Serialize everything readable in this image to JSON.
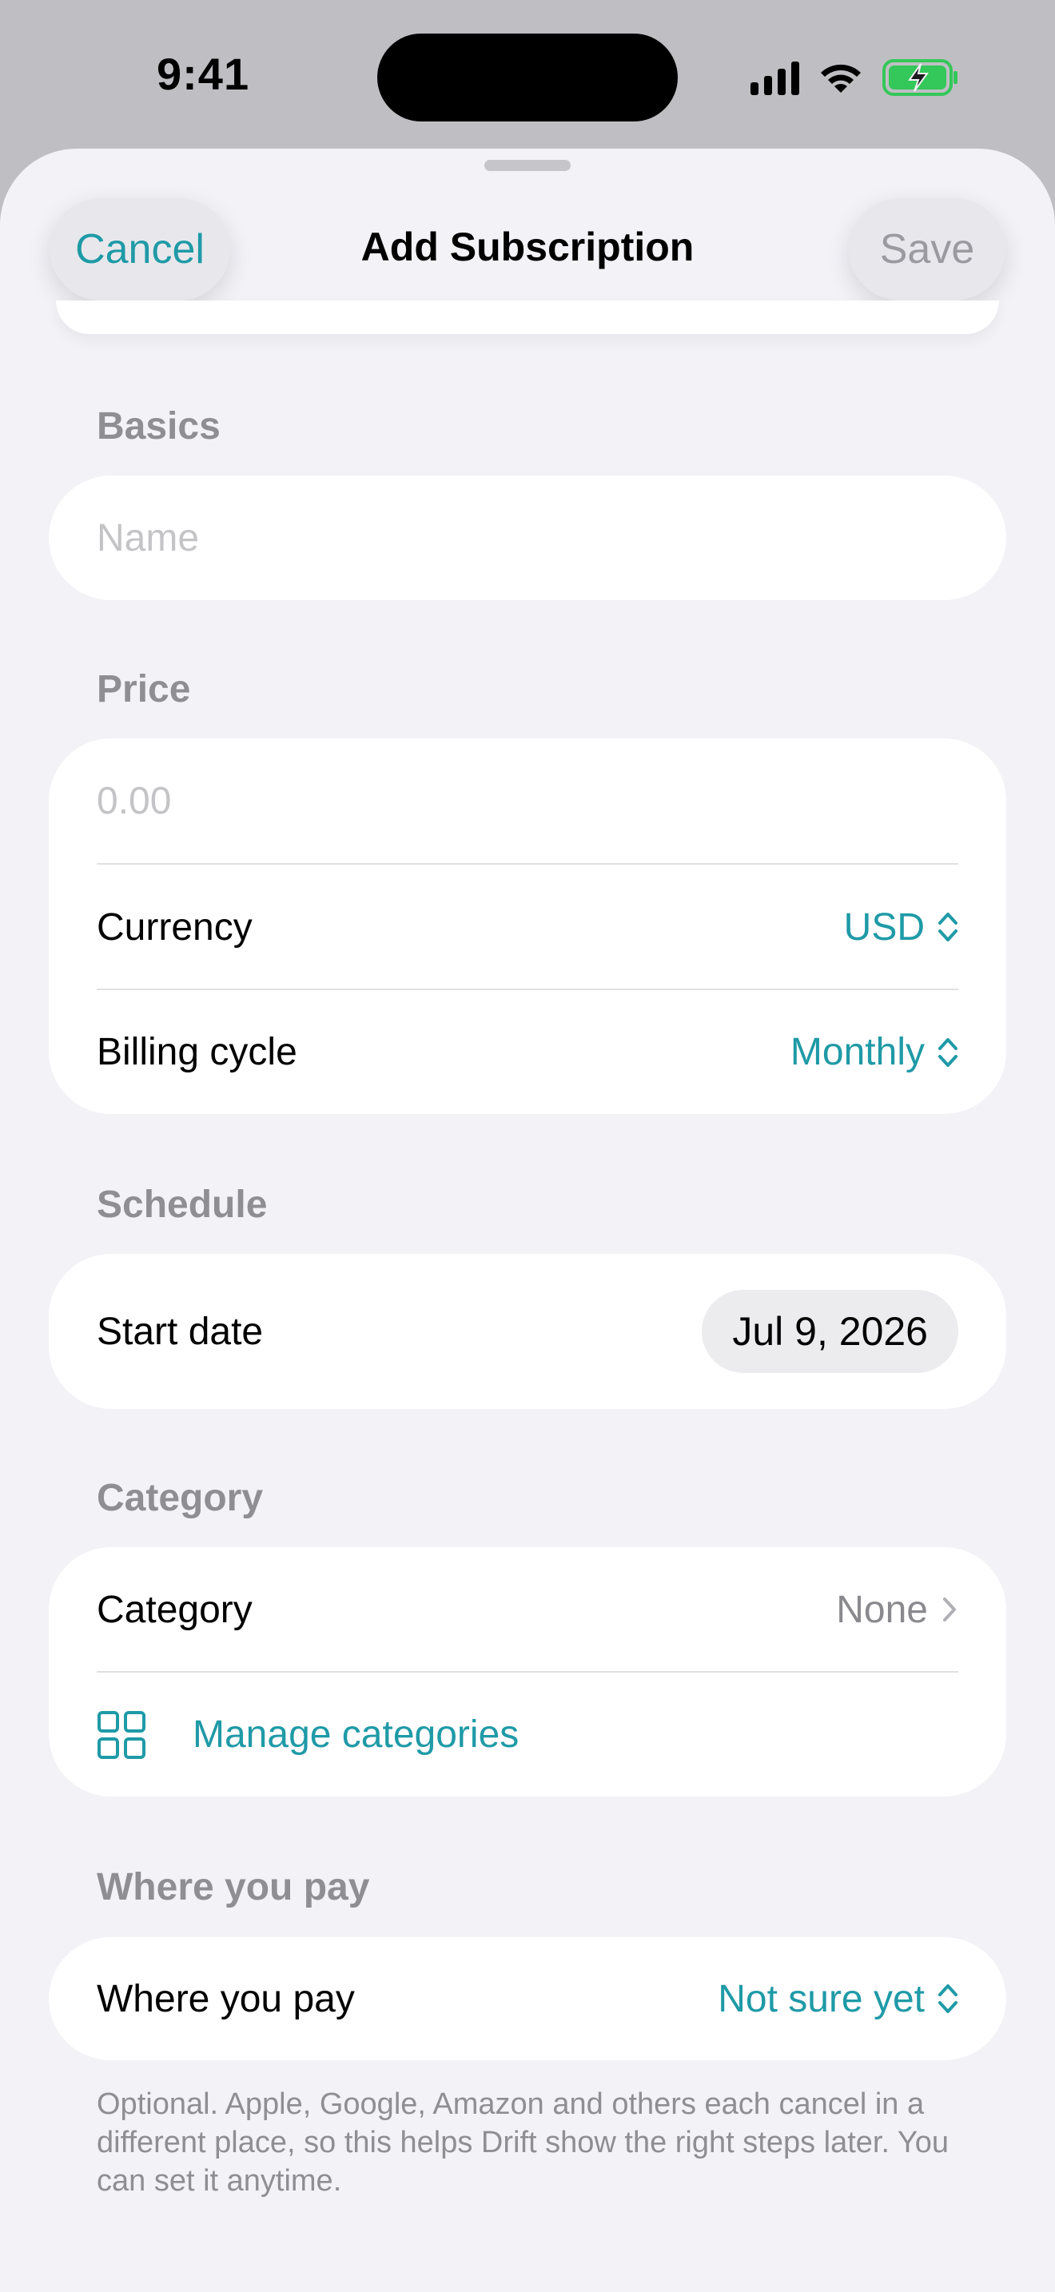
{
  "status_bar": {
    "time": "9:41",
    "icons": [
      "cellular-signal-icon",
      "wifi-icon",
      "battery-charging-icon"
    ],
    "battery_color": "#34c759"
  },
  "header": {
    "title": "Add Subscription",
    "cancel_label": "Cancel",
    "save_label": "Save",
    "save_enabled": false
  },
  "colors": {
    "accent": "#1f9aa7",
    "background": "#f2f2f7",
    "secondary_text": "#8e8e93"
  },
  "basics": {
    "header": "Basics",
    "name_placeholder": "Name",
    "name_value": ""
  },
  "price": {
    "header": "Price",
    "amount_placeholder": "0.00",
    "amount_value": "",
    "currency_label": "Currency",
    "currency_value": "USD",
    "billing_cycle_label": "Billing cycle",
    "billing_cycle_value": "Monthly"
  },
  "schedule": {
    "header": "Schedule",
    "start_date_label": "Start date",
    "start_date_value": "Jul 9, 2026"
  },
  "category": {
    "header": "Category",
    "category_label": "Category",
    "category_value": "None",
    "manage_label": "Manage categories",
    "manage_icon": "grid-icon"
  },
  "where_you_pay": {
    "header": "Where you pay",
    "label": "Where you pay",
    "value": "Not sure yet",
    "footnote": "Optional. Apple, Google, Amazon and others each cancel in a different place, so this helps Drift show the right steps later. You can set it anytime."
  }
}
